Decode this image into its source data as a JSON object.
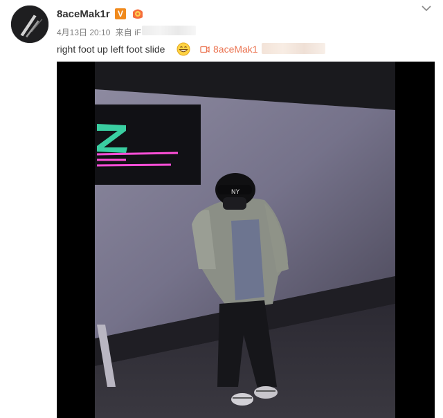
{
  "post": {
    "username": "8aceMak1r",
    "vip_badge": "V",
    "timestamp": "4月13日 20:10",
    "source_prefix": "来自 iF",
    "text": "right foot up  left foot slide",
    "video_link": "8aceMak1"
  },
  "icons": {
    "avatar": "avatar-image",
    "vip": "verified-v-icon",
    "level": "level-badge-icon",
    "smiley": "grin-emoji-icon",
    "video": "video-camera-icon",
    "menu": "chevron-down-icon"
  },
  "colors": {
    "username": "#333333",
    "meta": "#808080",
    "link": "#eb7350",
    "vip_badge": "#f08a1d",
    "neon_sign": "#ff4fd8",
    "neon_green": "#3fe3b0"
  }
}
